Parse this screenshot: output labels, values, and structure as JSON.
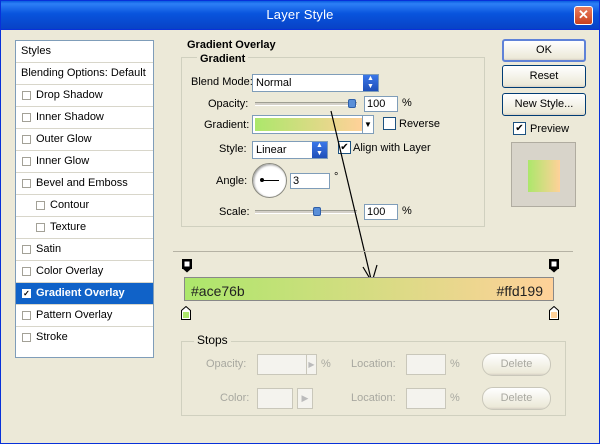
{
  "window": {
    "title": "Layer Style",
    "close_glyph": "✕"
  },
  "left_panel": {
    "items": [
      {
        "label": "Styles",
        "type": "header"
      },
      {
        "label": "Blending Options: Default",
        "type": "header"
      },
      {
        "label": "Drop Shadow",
        "checked": false
      },
      {
        "label": "Inner Shadow",
        "checked": false
      },
      {
        "label": "Outer Glow",
        "checked": false
      },
      {
        "label": "Inner Glow",
        "checked": false
      },
      {
        "label": "Bevel and Emboss",
        "checked": false
      },
      {
        "label": "Contour",
        "checked": false,
        "indent": true
      },
      {
        "label": "Texture",
        "checked": false,
        "indent": true
      },
      {
        "label": "Satin",
        "checked": false
      },
      {
        "label": "Color Overlay",
        "checked": false
      },
      {
        "label": "Gradient Overlay",
        "checked": true,
        "selected": true
      },
      {
        "label": "Pattern Overlay",
        "checked": false
      },
      {
        "label": "Stroke",
        "checked": false
      }
    ],
    "check_glyph": "☑"
  },
  "gradient_overlay": {
    "title": "Gradient Overlay",
    "group_title": "Gradient",
    "blend_mode": {
      "label": "Blend Mode:",
      "value": "Normal"
    },
    "opacity": {
      "label": "Opacity:",
      "value": "100",
      "unit": "%",
      "level": 1.0
    },
    "gradient": {
      "label": "Gradient:",
      "start_color": "#ace76b",
      "end_color": "#ffd199"
    },
    "reverse": {
      "label": "Reverse",
      "checked": false
    },
    "style": {
      "label": "Style:",
      "value": "Linear"
    },
    "align_with_layer": {
      "label": "Align with Layer",
      "checked": true
    },
    "angle": {
      "label": "Angle:",
      "value": "3",
      "unit": "°"
    },
    "scale": {
      "label": "Scale:",
      "value": "100",
      "unit": "%",
      "level": 0.5
    }
  },
  "buttons": {
    "ok": "OK",
    "reset": "Reset",
    "new_style": "New Style...",
    "preview": {
      "label": "Preview",
      "checked": true
    }
  },
  "gradient_editor": {
    "left_color_label": "#ace76b",
    "right_color_label": "#ffd199",
    "stops_title": "Stops",
    "opacity_label": "Opacity:",
    "color_label": "Color:",
    "location_label": "Location:",
    "percent": "%",
    "delete_label": "Delete"
  },
  "colors": {
    "accent": "#1062c8",
    "gradient_start": "#ace76b",
    "gradient_end": "#ffd199"
  }
}
